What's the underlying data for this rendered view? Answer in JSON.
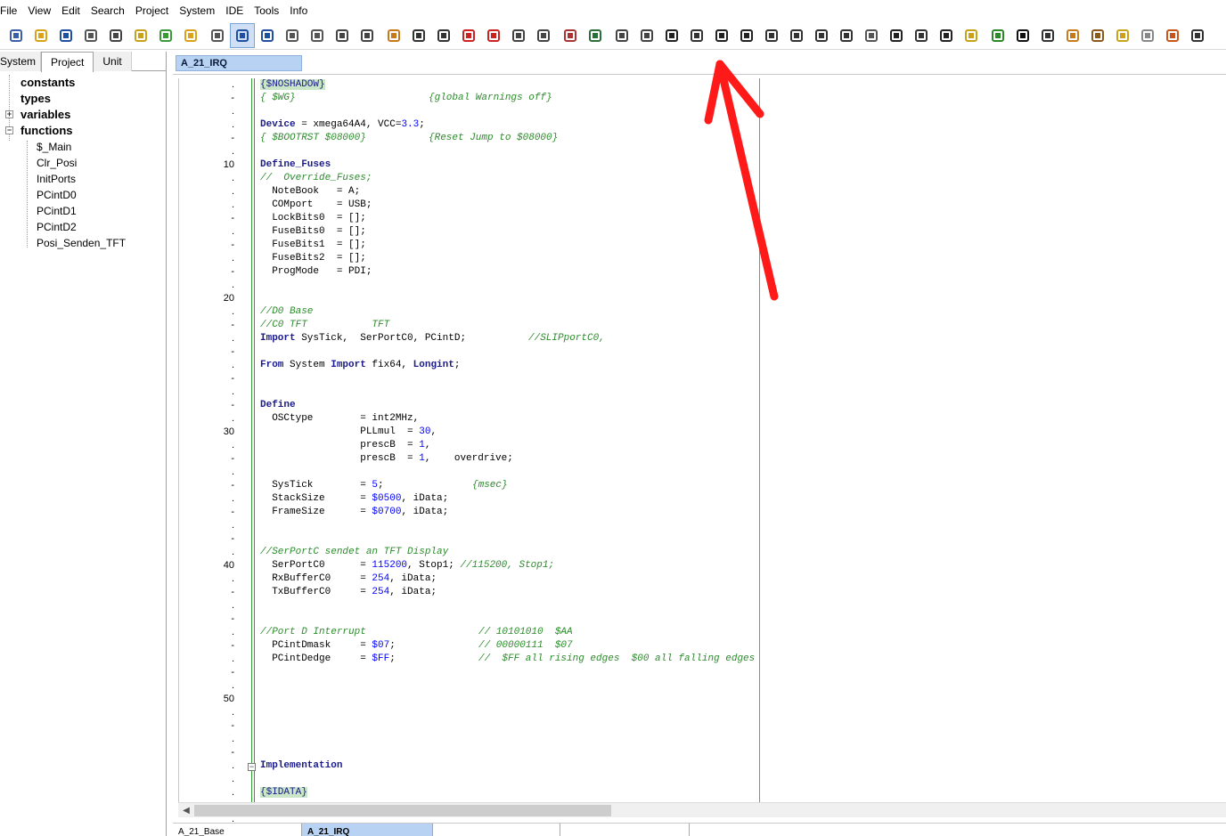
{
  "menu": [
    "File",
    "View",
    "Edit",
    "Search",
    "Project",
    "System",
    "IDE",
    "Tools",
    "Info"
  ],
  "toolbar": {
    "icons": [
      "project-manager-icon",
      "open-folder-icon",
      "save-icon",
      "save-all-icon",
      "print-icon",
      "keys-icon",
      "add-file-icon",
      "open-project-icon",
      "cut-icon",
      "toggle-view-icon",
      "window-icon",
      "search-icon",
      "search-replace-icon",
      "undo-icon",
      "redo-icon",
      "wizard-icon",
      "nav-back-icon",
      "nav-forward-icon",
      "arrow-up-icon",
      "arrow-down-icon",
      "preview-icon",
      "page-icon",
      "tools-icon",
      "calculator-icon",
      "link-icon",
      "spellcheck-icon",
      "help-icon",
      "key-lock-icon",
      "compile-hammer-icon",
      "build-chart-icon",
      "tree-icon",
      "filter-icon",
      "debug-bug-icon",
      "car-icon",
      "document-icon",
      "chip-icon",
      "list-icon",
      "stair-chart-icon",
      "eraser-icon",
      "board-icon",
      "font-icon",
      "superscript-icon",
      "pen-icon",
      "picture-icon",
      "pencil-icon",
      "notepad-icon",
      "book-icon",
      "network-icon"
    ],
    "active_index": 9
  },
  "left_panel": {
    "tabs": [
      "System",
      "Project",
      "Unit"
    ],
    "active_tab": 1,
    "tree": {
      "groups": [
        "constants",
        "types",
        "variables",
        "functions"
      ],
      "functions": [
        "$_Main",
        "Clr_Posi",
        "InitPorts",
        "PCintD0",
        "PCintD1",
        "PCintD2",
        "Posi_Senden_TFT"
      ]
    }
  },
  "editor": {
    "tab": "A_21_IRQ",
    "gutter": [
      ".",
      "-",
      ".",
      ".",
      "-",
      ".",
      "10",
      ".",
      ".",
      ".",
      "-",
      ".",
      "-",
      ".",
      "-",
      ".",
      "20",
      ".",
      "-",
      ".",
      "-",
      ".",
      "-",
      ".",
      "-",
      ".",
      "30",
      ".",
      "-",
      ".",
      "-",
      ".",
      "-",
      ".",
      "-",
      ".",
      "40",
      ".",
      "-",
      ".",
      "-",
      ".",
      "-",
      ".",
      "-",
      ".",
      "50",
      ".",
      "-",
      ".",
      "-",
      ".",
      ".",
      ".",
      "-",
      ".",
      "."
    ]
  },
  "code": {
    "nosha": "{$NOSHADOW}",
    "wg": "{ $WG}",
    "wg_comment": "{global Warnings off}",
    "device_kw": "Device",
    "device_rest": " = xmega64A4, VCC=",
    "vcc": "3.3",
    "device_end": ";",
    "bootrst": "{ $BOOTRST $08000}",
    "bootrst_comment": "{Reset Jump to $08000}",
    "define_fuses": "Define_Fuses",
    "override": "//  Override_Fuses;",
    "fuses": [
      "  NoteBook   = A;",
      "  COMport    = USB;",
      "  LockBits0  = [];",
      "  FuseBits0  = [];",
      "  FuseBits1  = [];",
      "  FuseBits2  = [];",
      "  ProgMode   = PDI;"
    ],
    "d0": "//D0 Base",
    "c0": "//C0 TFT           TFT",
    "import_kw": "Import",
    "import_rest": " SysTick,  SerPortC0, PCintD;",
    "import_comment": "//SLIPportC0,",
    "from_kw": "From",
    "system": " System ",
    "import2_kw": "Import",
    "fix64": " fix64, ",
    "longint_kw": "Longint",
    "semicolon": ";",
    "define_kw": "Define",
    "osc": "  OSCtype        = int2MHz,",
    "pllmul_pre": "                 PLLmul  = ",
    "pllmul_val": "30",
    "prescb1_pre": "                 prescB  = ",
    "prescb_val": "1",
    "prescb2_end": ",    overdrive;",
    "comma": ",",
    "systick_pre": "  SysTick        = ",
    "systick_val": "5",
    "systick_comment": "{msec}",
    "stack_pre": "  StackSize      = ",
    "stack_val": "$0500",
    "idata_suffix": ", iData;",
    "frame_pre": "  FrameSize      = ",
    "frame_val": "$0700",
    "serport_comment": "//SerPortC sendet an TFT Display",
    "serport_pre": "  SerPortC0      = ",
    "serport_val": "115200",
    "serport_mid": ", Stop1; ",
    "serport_c": "//115200, Stop1;",
    "rx_pre": "  RxBufferC0     = ",
    "buf_val": "254",
    "tx_pre": "  TxBufferC0     = ",
    "portd_comment": "//Port D Interrupt",
    "portd_c2": "// 10101010  $AA",
    "mask_pre": "  PCintDmask     = ",
    "mask_val": "$07",
    "mask_c": "// 00000111  $07",
    "edge_pre": "  PCintDedge     = ",
    "edge_val": "$FF",
    "edge_c": "//  $FF all rising edges  $00 all falling edges",
    "implementation": "Implementation",
    "idata": "{$IDATA}"
  },
  "bottom_tabs": [
    "A_21_Base",
    "A_21_IRQ",
    "",
    ""
  ],
  "bottom_active": 1,
  "colors": {
    "tab_active": "#b7d2f3",
    "arrow": "#ff1a1a",
    "comment": "#2e8b2e",
    "keyword": "#1a1a8c"
  }
}
